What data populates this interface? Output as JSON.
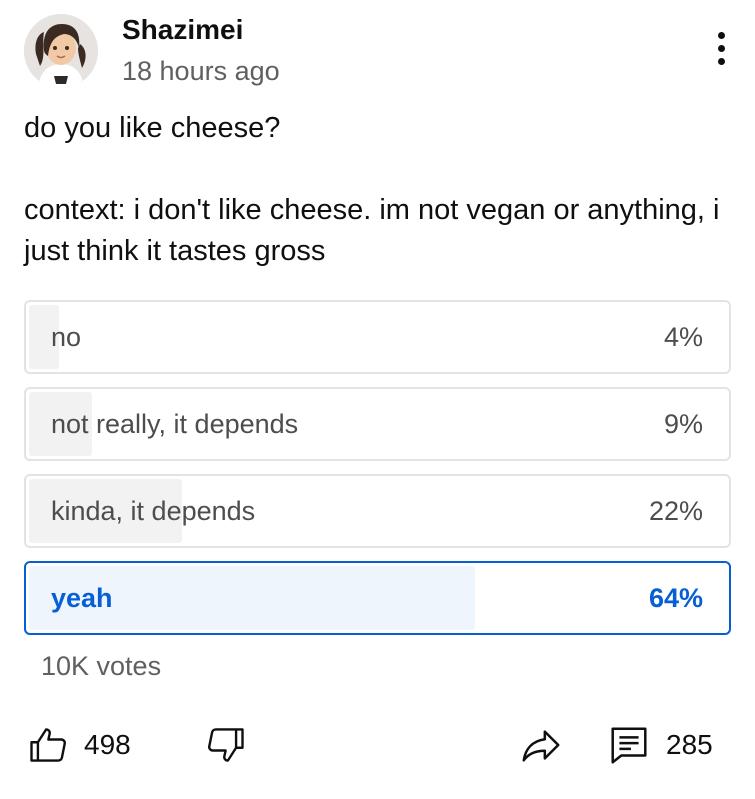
{
  "post": {
    "author": "Shazimei",
    "time": "18 hours ago",
    "question": "do you like cheese?",
    "context": "context: i don't like cheese. im not vegan or anything, i just think it tastes gross"
  },
  "poll": {
    "options": [
      {
        "label": "no",
        "percent_label": "4%",
        "percent": 4,
        "selected": false
      },
      {
        "label": "not really, it depends",
        "percent_label": "9%",
        "percent": 9,
        "selected": false
      },
      {
        "label": "kinda, it depends",
        "percent_label": "22%",
        "percent": 22,
        "selected": false
      },
      {
        "label": "yeah",
        "percent_label": "64%",
        "percent": 64,
        "selected": true
      }
    ],
    "votes": "10K votes"
  },
  "actions": {
    "likes": "498",
    "comments": "285"
  },
  "icons": {
    "menu": "more-vertical-icon",
    "like": "thumbs-up-icon",
    "dislike": "thumbs-down-icon",
    "share": "share-icon",
    "comment": "comment-icon"
  },
  "colors": {
    "accent": "#065fd4",
    "selected_fill": "#eef5fd",
    "bar_fill": "#f2f2f2",
    "border": "#e3e3e3",
    "secondary_text": "#606060"
  }
}
